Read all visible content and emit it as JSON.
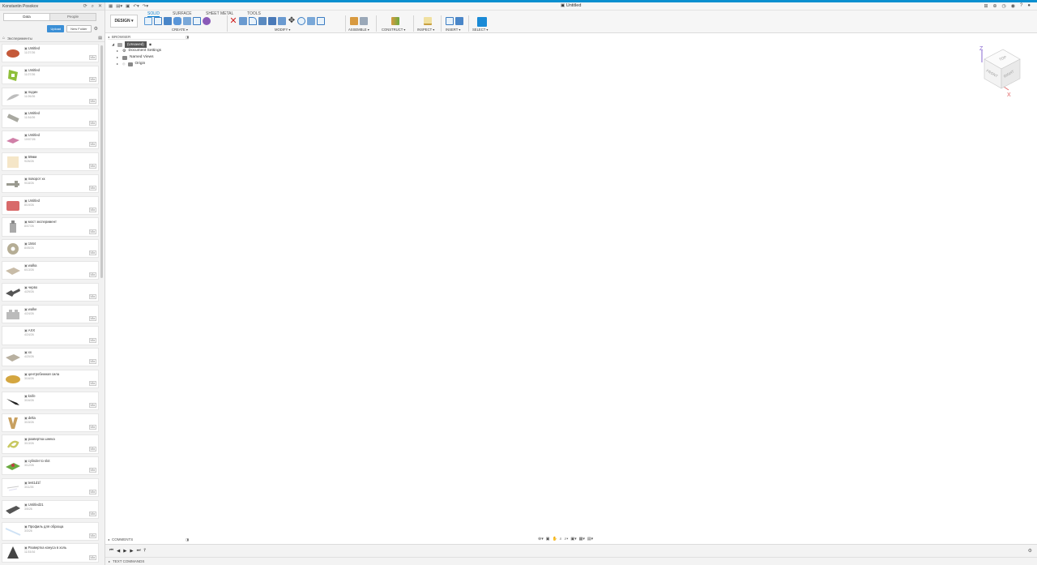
{
  "app": {
    "user": "Konstantin Posokov",
    "doc_title": "Untitled"
  },
  "data_panel": {
    "tabs": [
      "Data",
      "People"
    ],
    "upload_label": "Upload",
    "new_folder_label": "New Folder",
    "breadcrumb": "Эксперименты",
    "items": [
      {
        "name": "Untitled",
        "date": "11/27/26",
        "ver": "V1▾",
        "thumb": "oval",
        "color": "#c55a3a"
      },
      {
        "name": "Untitled",
        "date": "11/27/26",
        "ver": "V1▾",
        "thumb": "plate",
        "color": "#8fbf3a"
      },
      {
        "name": "подин",
        "date": "11/26/26",
        "ver": "V1▾",
        "thumb": "wing",
        "color": "#bdbdbd"
      },
      {
        "name": "Untitled",
        "date": "11/16/26",
        "ver": "V1▾",
        "thumb": "bone",
        "color": "#a8a8a0"
      },
      {
        "name": "Untitled",
        "date": "10/07/26",
        "ver": "V1▾",
        "thumb": "pad",
        "color": "#d080a8"
      },
      {
        "name": "59мм",
        "date": "9/26/26",
        "ver": "V1▾",
        "thumb": "block",
        "color": "#f5e6c8"
      },
      {
        "name": "поворот хк",
        "date": "9/18/26",
        "ver": "V1▾",
        "thumb": "bracket",
        "color": "#9a9a90"
      },
      {
        "name": "Untitled",
        "date": "8/19/26",
        "ver": "V1▾",
        "thumb": "brick",
        "color": "#d86a6a"
      },
      {
        "name": "мост эксперимент",
        "date": "8/07/26",
        "ver": "V1▾",
        "thumb": "tower",
        "color": "#aaa"
      },
      {
        "name": "1564",
        "date": "8/05/26",
        "ver": "V1▾",
        "thumb": "gear",
        "color": "#b5ad95"
      },
      {
        "name": "walka",
        "date": "6/13/26",
        "ver": "V1▾",
        "thumb": "slab",
        "color": "#c8bca8"
      },
      {
        "name": "черво",
        "date": "4/29/26",
        "ver": "V1▾",
        "thumb": "cross",
        "color": "#555"
      },
      {
        "name": "walke",
        "date": "4/24/26",
        "ver": "V1▾",
        "thumb": "lego",
        "color": "#bbb"
      },
      {
        "name": "АХХ",
        "date": "4/24/26",
        "ver": "V1▾",
        "thumb": "empty",
        "color": "#eee"
      },
      {
        "name": "хх",
        "date": "4/20/26",
        "ver": "V1▾",
        "thumb": "slab",
        "color": "#b8b0a0"
      },
      {
        "name": "центробежная сила",
        "date": "3/16/26",
        "ver": "V1▾",
        "thumb": "blob",
        "color": "#d4a640"
      },
      {
        "name": "knife",
        "date": "3/16/26",
        "ver": "V1▾",
        "thumb": "knife",
        "color": "#222"
      },
      {
        "name": "delta",
        "date": "3/15/26",
        "ver": "V1▾",
        "thumb": "delta",
        "color": "#c8a060"
      },
      {
        "name": "развертка шнека",
        "date": "3/13/26",
        "ver": "V1▾",
        "thumb": "spiral",
        "color": "#c8c860"
      },
      {
        "name": "cylinder to slot",
        "date": "3/12/26",
        "ver": "V1▾",
        "thumb": "board",
        "color": "#6aaa40"
      },
      {
        "name": "test1d1f",
        "date": "3/11/26",
        "ver": "V1▾",
        "thumb": "light",
        "color": "#ddd"
      },
      {
        "name": "Untitled21",
        "date": "3/5/26",
        "ver": "V1▾",
        "thumb": "tube",
        "color": "#555"
      },
      {
        "name": "Профиль для образца",
        "date": "3/3/26",
        "ver": "V1▾",
        "thumb": "profile",
        "color": "#cfe2f5"
      },
      {
        "name": "Развертка конуса в холь",
        "date": "11/15/16",
        "ver": "V1▾",
        "thumb": "cone",
        "color": "#444"
      }
    ]
  },
  "ribbon": {
    "design_label": "DESIGN ▾",
    "tabs": [
      "SOLID",
      "SURFACE",
      "SHEET METAL",
      "TOOLS"
    ],
    "groups": [
      "CREATE ▾",
      "MODIFY ▾",
      "ASSEMBLE ▾",
      "CONSTRUCT ▾",
      "INSPECT ▾",
      "INSERT ▾",
      "SELECT ▾"
    ]
  },
  "browser": {
    "header": "BROWSER",
    "root": "(Unsaved)",
    "nodes": [
      "Document Settings",
      "Named Views",
      "Origin"
    ]
  },
  "viewcube": {
    "top": "TOP",
    "front": "FRONT",
    "right": "RIGHT",
    "x": "X",
    "z": "Z"
  },
  "comments_label": "COMMENTS",
  "text_commands_label": "TEXT COMMANDS",
  "colors": {
    "accent": "#0a8fcf",
    "upload": "#3b8fd6"
  }
}
